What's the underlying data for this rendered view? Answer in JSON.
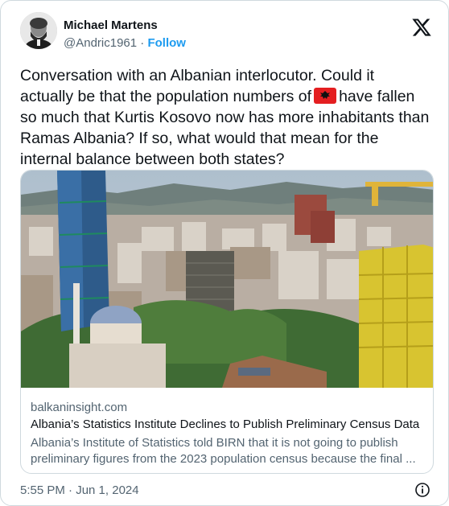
{
  "author": {
    "name": "Michael Martens",
    "handle": "@Andric1961",
    "separator": "·",
    "follow_label": "Follow"
  },
  "tweet": {
    "text_before_flag": "Conversation with an Albanian interlocutor. Could it actually be that the population numbers of",
    "flag_icon": "albania-flag-emoji",
    "text_after_flag": "have fallen so much that Kurtis Kosovo now has more inhabitants than Ramas Albania? If so, what would that mean for the internal balance between both states?"
  },
  "link_card": {
    "domain": "balkaninsight.com",
    "title": "Albania’s Statistics Institute Declines to Publish Preliminary Census Data",
    "description_line1": "Albania’s Institute of Statistics told BIRN that it is not going to publish",
    "description_line2": "preliminary figures from the 2023 population census because the final ..."
  },
  "footer": {
    "timestamp": "5:55 PM · Jun 1, 2024",
    "info_icon": "info-icon"
  },
  "colors": {
    "text": "#0f1419",
    "secondary": "#536471",
    "accent": "#1d9bf0",
    "border": "#cfd9de",
    "flag_red": "#e41e20"
  }
}
